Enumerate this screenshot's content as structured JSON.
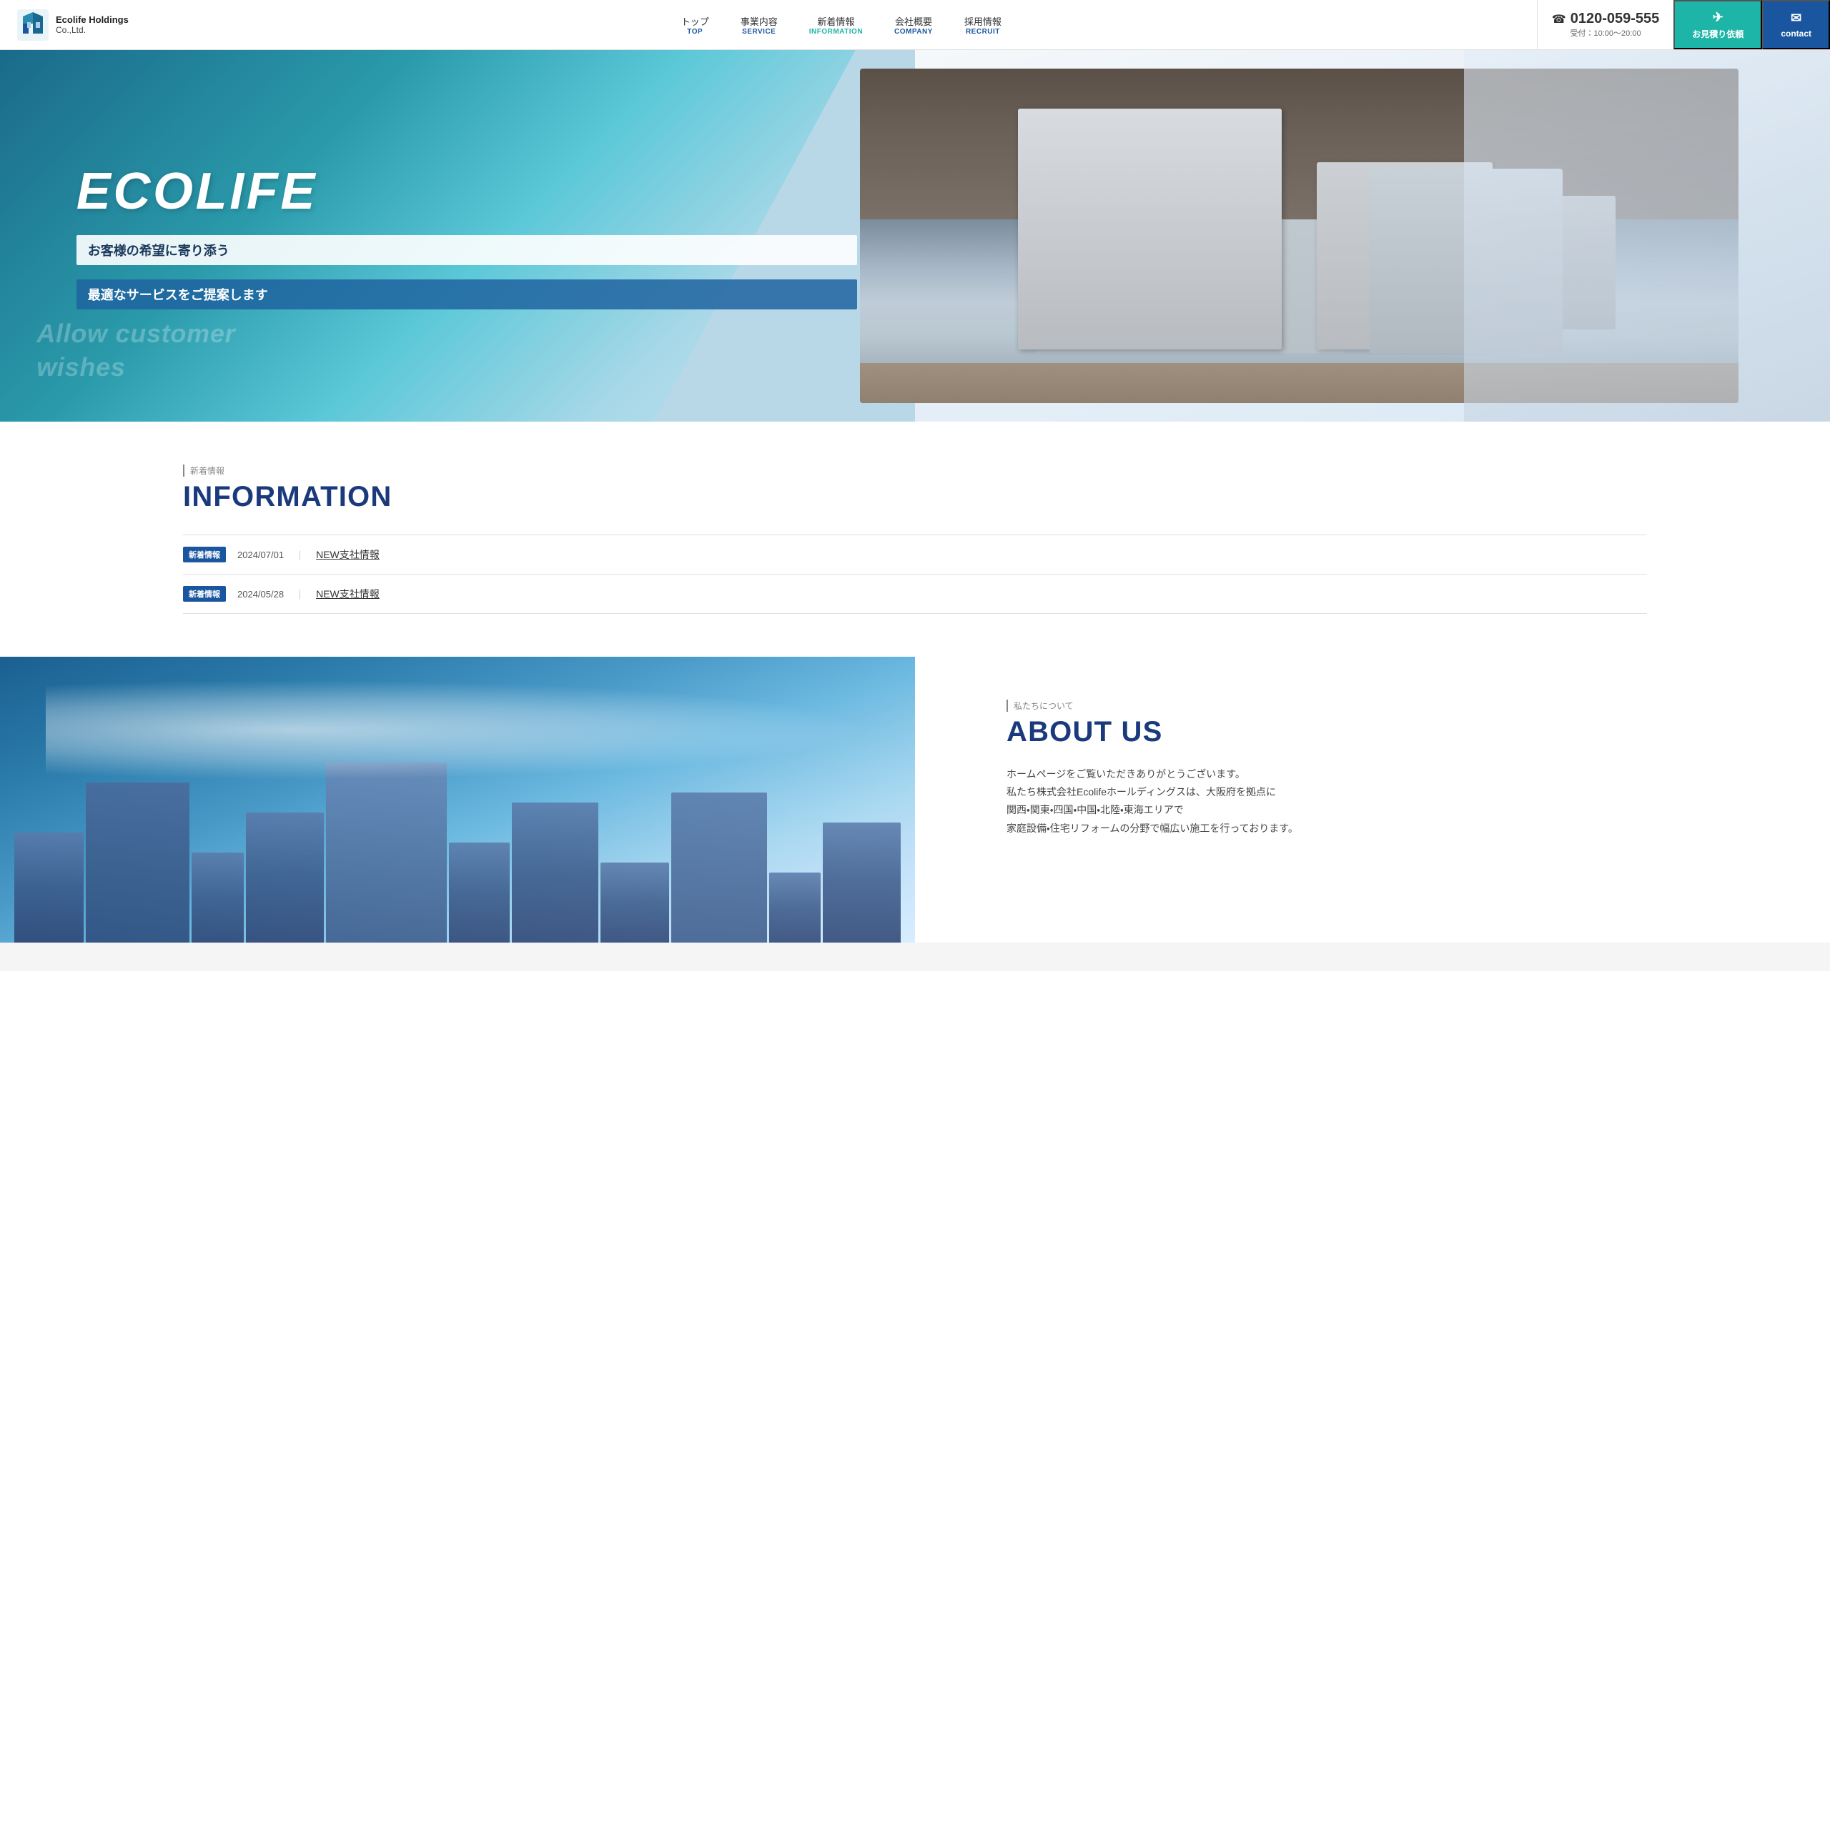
{
  "header": {
    "logo_line1": "Ecolife Holdings",
    "logo_line2": "Co.,Ltd.",
    "nav": [
      {
        "main": "トップ",
        "sub": "TOP"
      },
      {
        "main": "事業内容",
        "sub": "SERVICE"
      },
      {
        "main": "新着情報",
        "sub": "INFORMATION"
      },
      {
        "main": "会社概要",
        "sub": "COMPANY"
      },
      {
        "main": "採用情報",
        "sub": "RECRUIT"
      }
    ],
    "phone_icon": "☎",
    "phone_number": "0120-059-555",
    "phone_hours": "受付：10:00〜20:00",
    "cta_estimate_icon": "✈",
    "cta_estimate_label": "お見積り依頼",
    "cta_contact_icon": "✉",
    "cta_contact_label": "contact"
  },
  "hero": {
    "title": "ECOLIFE",
    "subtitle1": "お客様の希望に寄り添う",
    "subtitle2": "最適なサービスをご提案します",
    "watermark_line1": "Allow customer",
    "watermark_line2": "wishes"
  },
  "information": {
    "section_label": "新着情報",
    "section_title": "INFORMATION",
    "items": [
      {
        "badge": "新着情報",
        "date": "2024/07/01",
        "separator": "｜",
        "title": "NEW支社情報"
      },
      {
        "badge": "新着情報",
        "date": "2024/05/28",
        "separator": "｜",
        "title": "NEW支社情報"
      }
    ]
  },
  "about": {
    "section_label": "私たちについて",
    "section_title": "ABOUT US",
    "text_lines": [
      "ホームページをご覧いただきありがとうございます。",
      "私たち株式会社Ecolifeホールディングスは、大阪府を拠点に",
      "関西・関東・四国・中国・北陸・東海エリアで",
      "家庭設備・住宅リフォームの分野で幅広い施工を行っております。"
    ]
  },
  "colors": {
    "primary_blue": "#1a3a7c",
    "accent_teal": "#1db5a8",
    "nav_blue": "#1a56a0",
    "badge_blue": "#1a56a0"
  }
}
